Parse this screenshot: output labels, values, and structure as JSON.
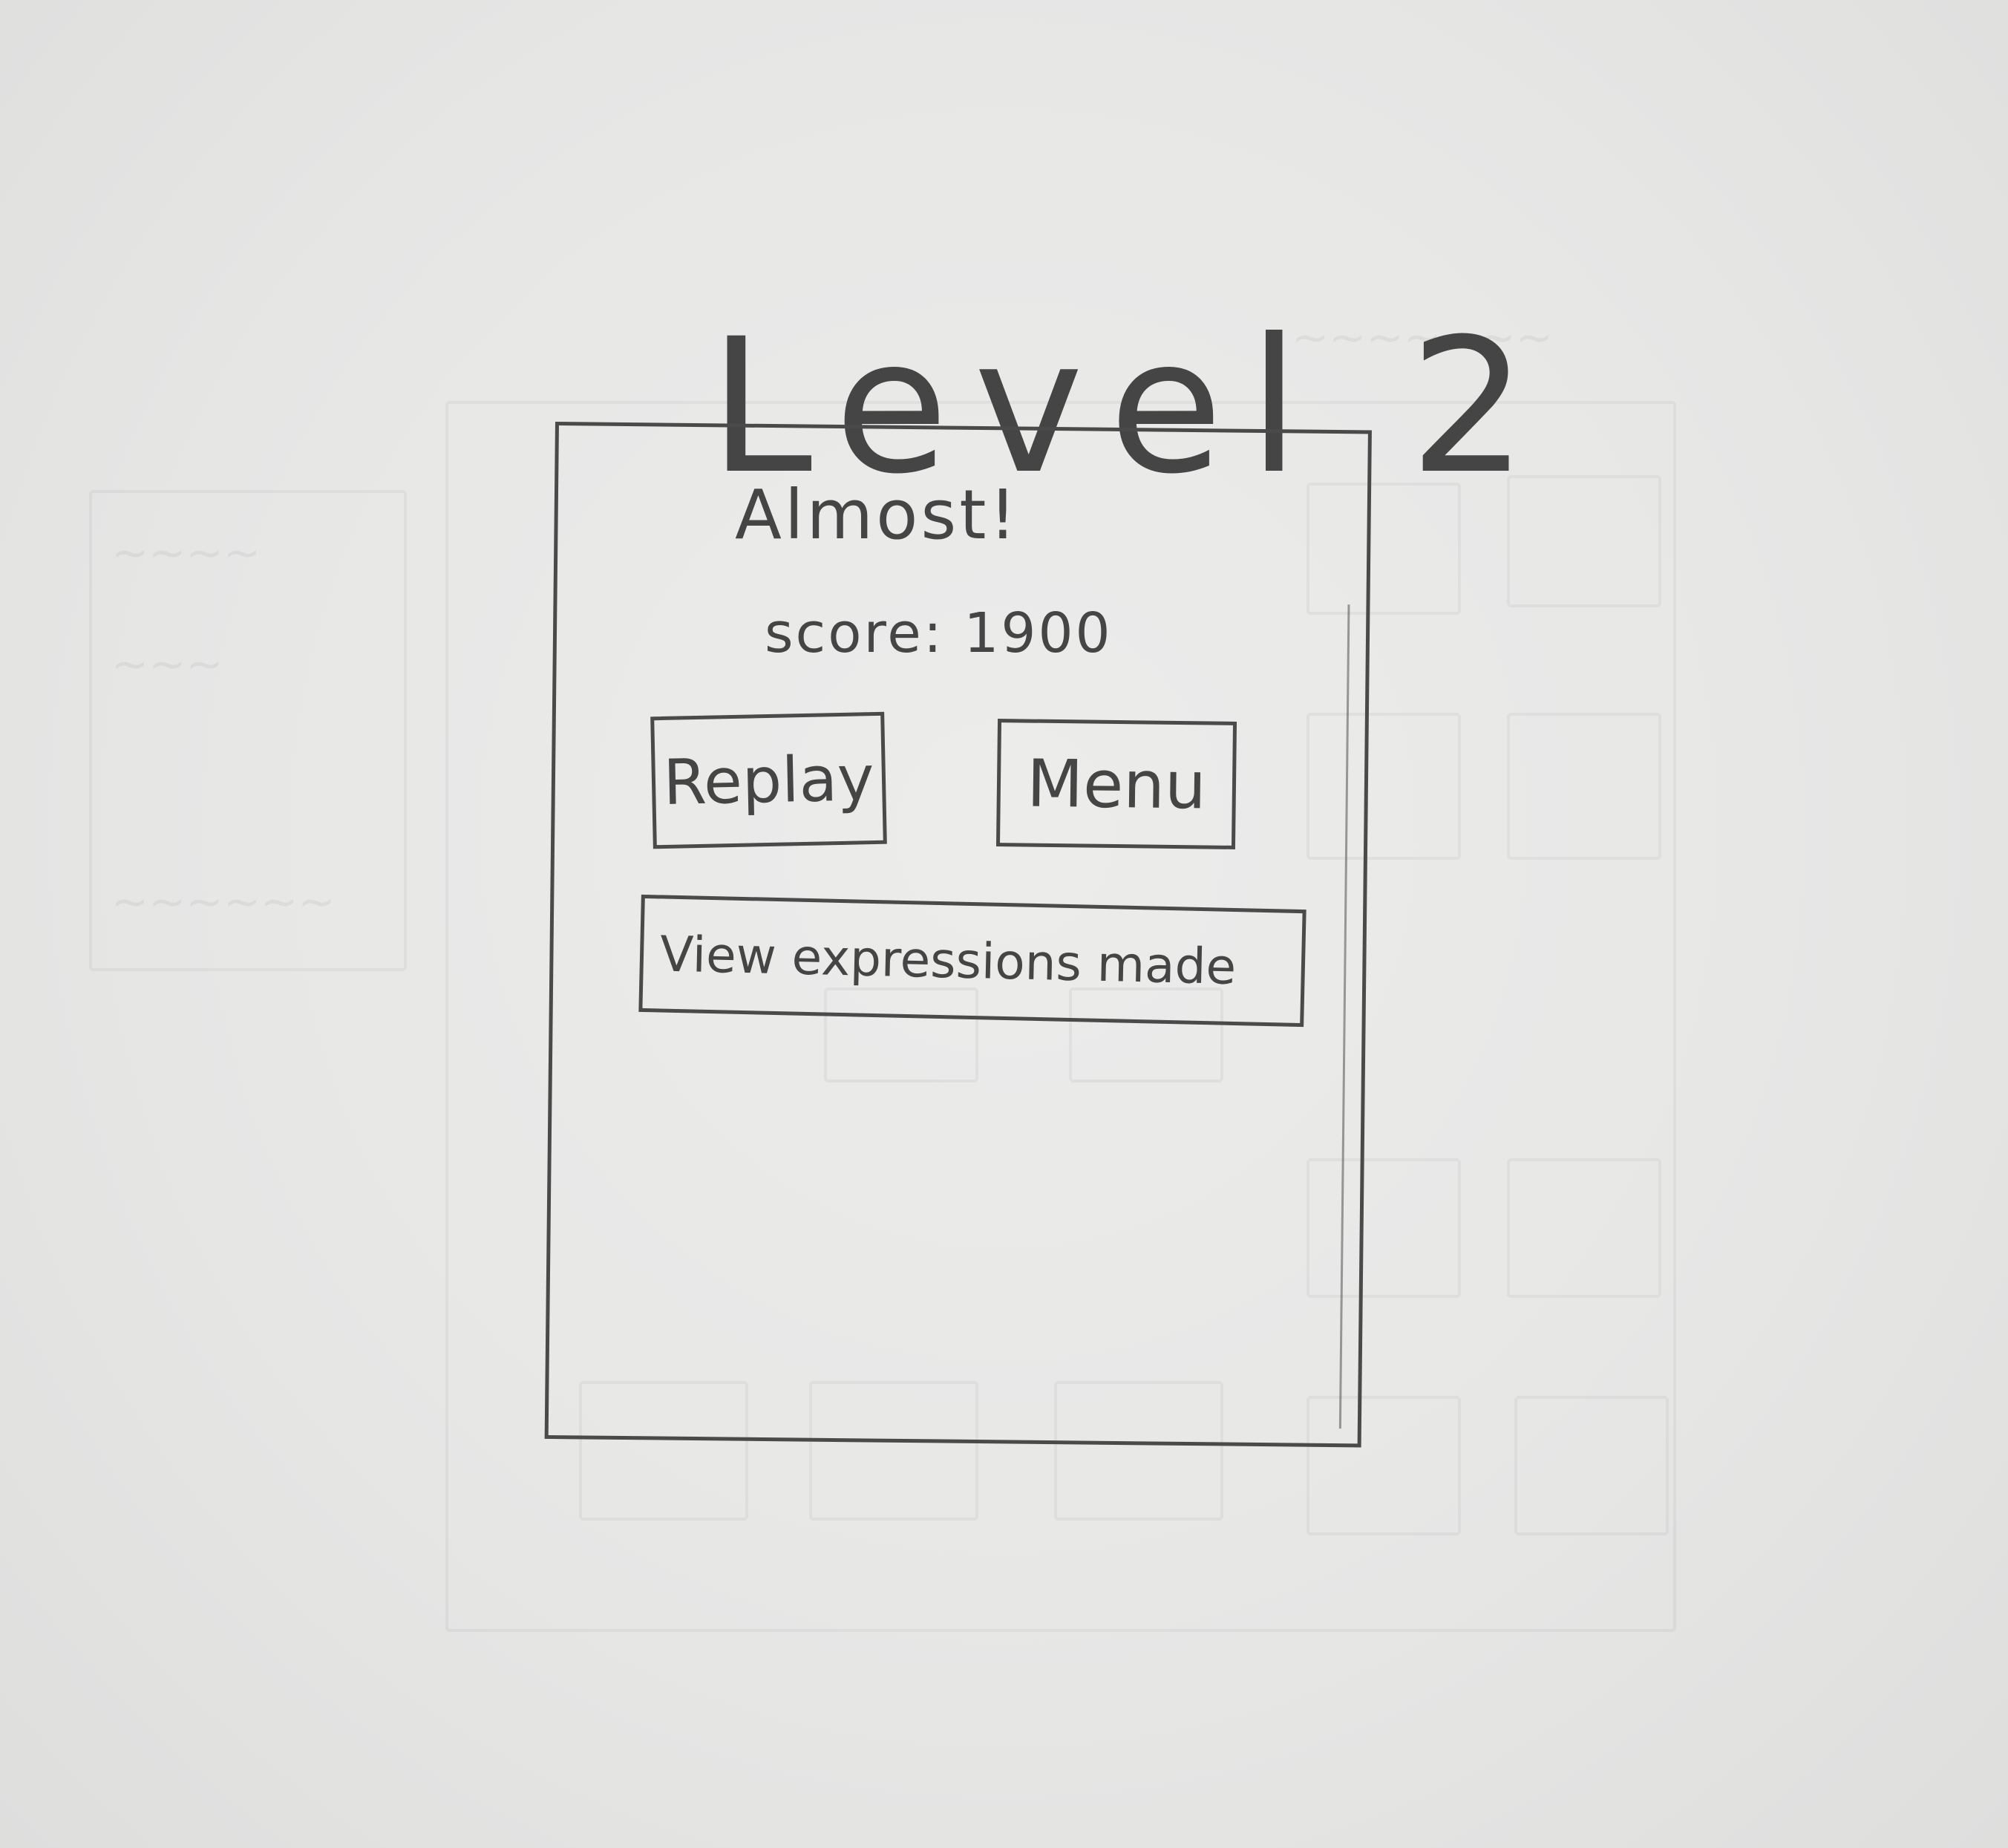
{
  "title": "Level 2",
  "result": {
    "message": "Almost!",
    "score_label": "score:",
    "score_value": "1900"
  },
  "buttons": {
    "replay": "Replay",
    "menu": "Menu",
    "view_expressions": "View expressions made"
  }
}
